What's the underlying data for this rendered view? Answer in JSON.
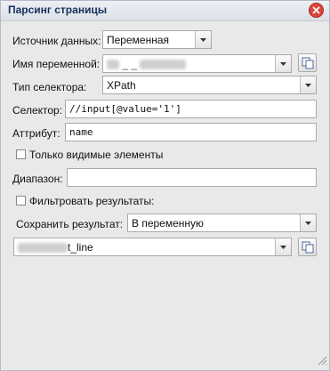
{
  "dialog": {
    "title": "Парсинг страницы",
    "close_icon": "close-icon"
  },
  "form": {
    "data_source_label": "Источник данных:",
    "data_source_value": "Переменная",
    "variable_name_label": "Имя переменной:",
    "variable_name_value": "",
    "selector_type_label": "Тип селектора:",
    "selector_type_value": "XPath",
    "selector_label": "Селектор:",
    "selector_value": "//input[@value='1']",
    "attribute_label": "Аттрибут:",
    "attribute_value": "name",
    "visible_only_label": "Только видимые элементы",
    "range_label": "Диапазон:",
    "range_value": "",
    "filter_label": "Фильтровать результаты:",
    "save_result_label": "Сохранить результат:",
    "save_result_value": "В переменную",
    "output_variable_value": "t_line"
  }
}
